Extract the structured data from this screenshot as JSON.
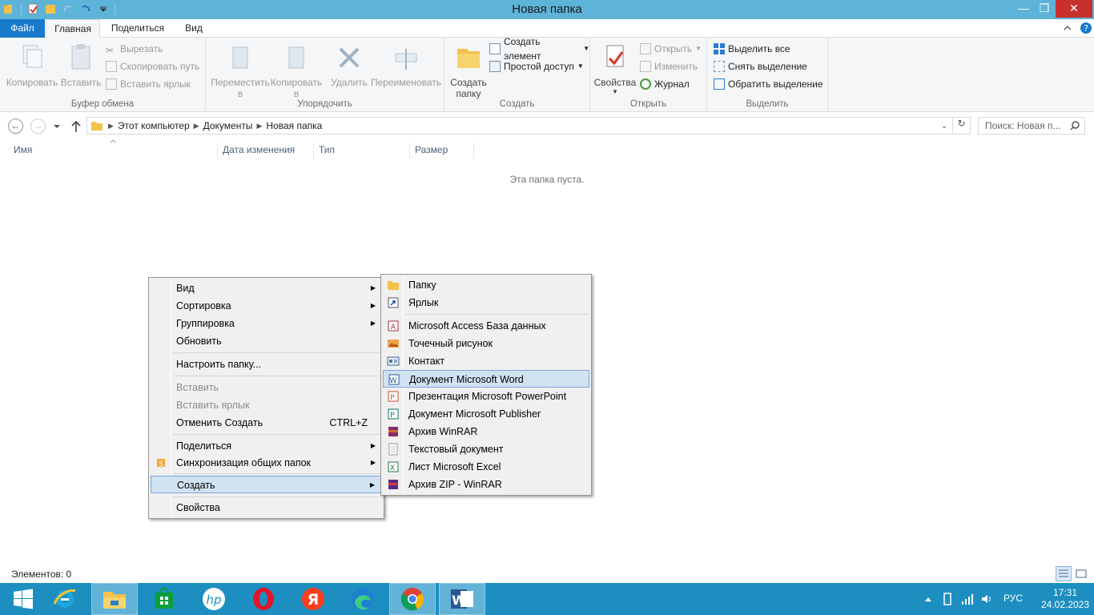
{
  "window": {
    "title": "Новая папка"
  },
  "ribbon_tabs": [
    "Файл",
    "Главная",
    "Поделиться",
    "Вид"
  ],
  "ribbon": {
    "clipboard": {
      "title": "Буфер обмена",
      "copy": "Копировать",
      "paste": "Вставить",
      "cut": "Вырезать",
      "copy_path": "Скопировать путь",
      "paste_shortcut": "Вставить ярлык"
    },
    "organize": {
      "title": "Упорядочить",
      "move_to": "Переместить",
      "move_to_2": "в",
      "copy_to": "Копировать",
      "copy_to_2": "в",
      "delete": "Удалить",
      "rename": "Переименовать"
    },
    "create": {
      "title": "Создать",
      "new_folder": "Создать",
      "new_folder_2": "папку",
      "new_item": "Создать элемент",
      "easy_access": "Простой доступ"
    },
    "open": {
      "title": "Открыть",
      "properties": "Свойства",
      "open": "Открыть",
      "edit": "Изменить",
      "history": "Журнал"
    },
    "select": {
      "title": "Выделить",
      "select_all": "Выделить все",
      "select_none": "Снять выделение",
      "invert": "Обратить выделение"
    }
  },
  "address": {
    "crumbs": [
      "Этот компьютер",
      "Документы",
      "Новая папка"
    ],
    "search_placeholder": "Поиск: Новая п..."
  },
  "columns": [
    "Имя",
    "Дата изменения",
    "Тип",
    "Размер"
  ],
  "empty_text": "Эта папка пуста.",
  "context_menu": {
    "items": [
      {
        "label": "Вид",
        "submenu": true
      },
      {
        "label": "Сортировка",
        "submenu": true
      },
      {
        "label": "Группировка",
        "submenu": true
      },
      {
        "label": "Обновить"
      },
      {
        "label": "Настроить папку..."
      },
      {
        "label": "Вставить",
        "disabled": true
      },
      {
        "label": "Вставить ярлык",
        "disabled": true
      },
      {
        "label": "Отменить Создать",
        "shortcut": "CTRL+Z"
      },
      {
        "label": "Поделиться",
        "submenu": true
      },
      {
        "label": "Синхронизация общих папок",
        "submenu": true
      },
      {
        "label": "Создать",
        "submenu": true,
        "selected": true
      },
      {
        "label": "Свойства"
      }
    ]
  },
  "submenu_new": {
    "items": [
      {
        "label": "Папку",
        "icon": "folder-icon"
      },
      {
        "label": "Ярлык",
        "icon": "shortcut-icon"
      },
      {
        "label": "Microsoft Access База данных",
        "icon": "access-icon"
      },
      {
        "label": "Точечный рисунок",
        "icon": "bitmap-icon"
      },
      {
        "label": "Контакт",
        "icon": "contact-icon"
      },
      {
        "label": "Документ Microsoft Word",
        "icon": "word-icon",
        "selected": true
      },
      {
        "label": "Презентация Microsoft PowerPoint",
        "icon": "powerpoint-icon"
      },
      {
        "label": "Документ Microsoft Publisher",
        "icon": "publisher-icon"
      },
      {
        "label": "Архив WinRAR",
        "icon": "winrar-icon"
      },
      {
        "label": "Текстовый документ",
        "icon": "text-doc-icon"
      },
      {
        "label": "Лист Microsoft Excel",
        "icon": "excel-icon"
      },
      {
        "label": "Архив ZIP - WinRAR",
        "icon": "zip-icon"
      }
    ]
  },
  "status": {
    "items_count": "Элементов: 0"
  },
  "taskbar": {
    "apps": [
      "start-button",
      "internet-explorer",
      "file-explorer",
      "store",
      "hp",
      "opera",
      "yandex",
      "edge",
      "chrome",
      "word"
    ],
    "lang": "РУС",
    "time": "17:31",
    "date": "24.02.2023"
  },
  "colors": {
    "titlebar": "#5eb3d9",
    "file_tab": "#1979ca",
    "taskbar": "#1c8fc0",
    "selection": "#d1e2f2"
  }
}
